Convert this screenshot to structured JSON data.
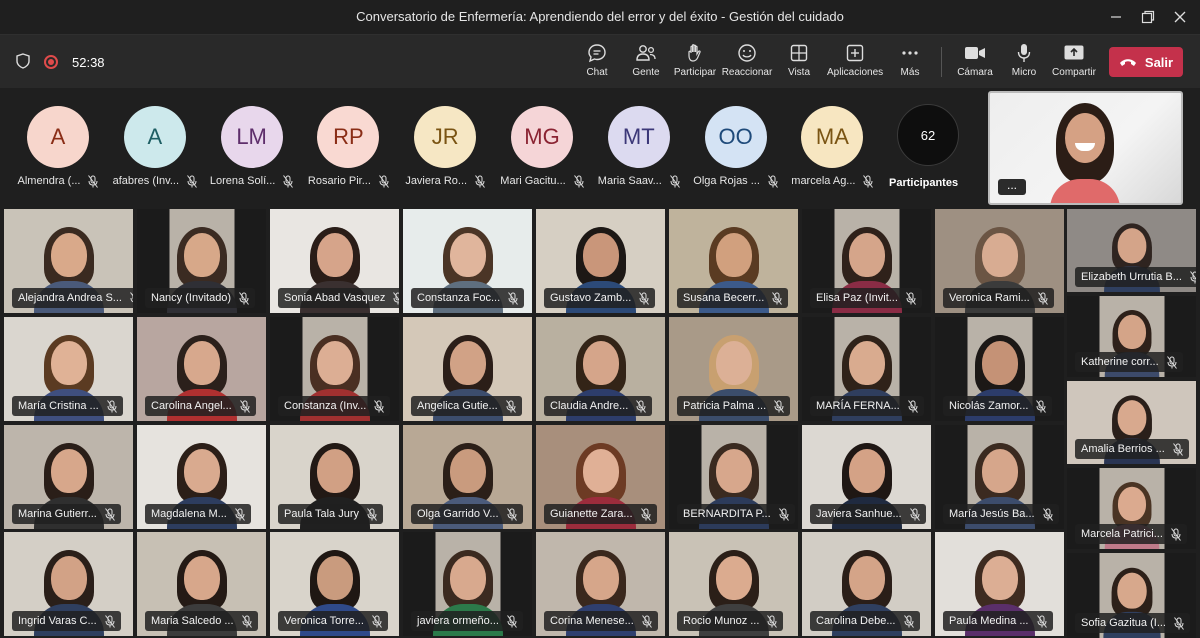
{
  "window": {
    "title": "Conversatorio de Enfermería: Aprendiendo del error y del éxito - Gestión del cuidado"
  },
  "toolbar": {
    "timer": "52:38",
    "buttons": [
      {
        "label": "Chat"
      },
      {
        "label": "Gente"
      },
      {
        "label": "Participar"
      },
      {
        "label": "Reaccionar"
      },
      {
        "label": "Vista"
      },
      {
        "label": "Aplicaciones"
      },
      {
        "label": "Más"
      },
      {
        "label": "Cámara"
      },
      {
        "label": "Micro"
      },
      {
        "label": "Compartir"
      }
    ],
    "leave_label": "Salir"
  },
  "avatars": [
    {
      "initials": "A",
      "name": "Almendra (...",
      "bg": "#f7d6cc",
      "fg": "#8a2d16"
    },
    {
      "initials": "A",
      "name": "afabres (Inv...",
      "bg": "#cde9ec",
      "fg": "#1d5e63"
    },
    {
      "initials": "LM",
      "name": "Lorena Solí...",
      "bg": "#e8d7ec",
      "fg": "#5e2e6b"
    },
    {
      "initials": "RP",
      "name": "Rosario Pir...",
      "bg": "#f9d9d2",
      "fg": "#8a2d16"
    },
    {
      "initials": "JR",
      "name": "Javiera Ro...",
      "bg": "#f6e7c4",
      "fg": "#7a5413"
    },
    {
      "initials": "MG",
      "name": "Mari Gacitu...",
      "bg": "#f5d5d7",
      "fg": "#8a2332"
    },
    {
      "initials": "MT",
      "name": "Maria Saav...",
      "bg": "#dcdaf0",
      "fg": "#3b3778"
    },
    {
      "initials": "OO",
      "name": "Olga Rojas ...",
      "bg": "#d4e3f4",
      "fg": "#1e4a7a"
    },
    {
      "initials": "MA",
      "name": "marcela Ag...",
      "bg": "#f7e6c1",
      "fg": "#7a5413"
    }
  ],
  "participants": {
    "count": "62",
    "label": "Participantes"
  },
  "self_view": {
    "more": "..."
  },
  "videos": [
    {
      "name": "Alejandra Andrea S...",
      "bg": "#c9c3b8",
      "skin": "#d9a98a",
      "hair": "#3a2a20",
      "cloth": "#4a5a7a"
    },
    {
      "name": "Nancy (Invitado)",
      "bg": "#1b1b1b",
      "skin": "#d7a889",
      "hair": "#3b2b22",
      "cloth": "#2f2f35"
    },
    {
      "name": "Sonia Abad Vasquez",
      "bg": "#e9e6e2",
      "skin": "#d6a48a",
      "hair": "#2a1d18",
      "cloth": "#3a3030"
    },
    {
      "name": "Constanza Foc...",
      "bg": "#e7eceb",
      "skin": "#e0b59c",
      "hair": "#4b3526",
      "cloth": "#5f6f7f"
    },
    {
      "name": "Gustavo Zamb...",
      "bg": "#d6cfc3",
      "skin": "#c9967a",
      "hair": "#1d1815",
      "cloth": "#2c4a78"
    },
    {
      "name": "Susana Becerr...",
      "bg": "#bfb39c",
      "skin": "#d1a07e",
      "hair": "#5a3b22",
      "cloth": "#3c5a8a"
    },
    {
      "name": "Elisa Paz (Invit...",
      "bg": "#1b1b1b",
      "skin": "#d5a58a",
      "hair": "#2f211a",
      "cloth": "#8a2c45"
    },
    {
      "name": "Veronica Rami...",
      "bg": "#9e9082",
      "skin": "#d8ac92",
      "hair": "#6b5544",
      "cloth": "#3b3b3b"
    },
    {
      "name": "Elizabeth Urrutia B...",
      "bg": "#8f8a86",
      "skin": "#d4a489",
      "hair": "#2f2420",
      "cloth": "#2f3f5f"
    },
    {
      "name": "María Cristina ...",
      "bg": "#dad6cf",
      "skin": "#e0b296",
      "hair": "#5b3b22",
      "cloth": "#3f4f7f"
    },
    {
      "name": "Carolina Angel...",
      "bg": "#b8a6a0",
      "skin": "#d7a88d",
      "hair": "#2b201b",
      "cloth": "#b03030"
    },
    {
      "name": "Constanza (Inv...",
      "bg": "#1b1b1b",
      "skin": "#dcae94",
      "hair": "#4a2f22",
      "cloth": "#a13030"
    },
    {
      "name": "Angelica Gutie...",
      "bg": "#d4c8b8",
      "skin": "#d1a286",
      "hair": "#2b1e18",
      "cloth": "#3c4d6d"
    },
    {
      "name": "Claudia Andre...",
      "bg": "#b9b0a0",
      "skin": "#d5a58a",
      "hair": "#332417",
      "cloth": "#2d3d6b"
    },
    {
      "name": "Patricia Palma ...",
      "bg": "#a99a88",
      "skin": "#dcb096",
      "hair": "#c8a070",
      "cloth": "#3b4d6b"
    },
    {
      "name": "MARÍA FERNA...",
      "bg": "#1b1b1b",
      "skin": "#d9ab8f",
      "hair": "#2f2219",
      "cloth": "#2f3e5e"
    },
    {
      "name": "Nicolás Zamor...",
      "bg": "#1b1b1b",
      "skin": "#c59276",
      "hair": "#1c1816",
      "cloth": "#2c3c6a"
    },
    {
      "name": "Katherine corr...",
      "bg": "#1b1b1b",
      "skin": "#d4a488",
      "hair": "#2e211a",
      "cloth": "#3c4a6a"
    },
    {
      "name": "Amalia Berrios ...",
      "bg": "#cfc6bc",
      "skin": "#d8a98e",
      "hair": "#2a1f1a",
      "cloth": "#2a3553"
    },
    {
      "name": "Marina Gutierr...",
      "bg": "#bdb5ab",
      "skin": "#d7a78b",
      "hair": "#2a1e18",
      "cloth": "#2f2f2f"
    },
    {
      "name": "Magdalena M...",
      "bg": "#e6e3de",
      "skin": "#d9aa8f",
      "hair": "#2c1f18",
      "cloth": "#2d3d5f"
    },
    {
      "name": "Paula Tala Jury",
      "bg": "#d9d4cb",
      "skin": "#d1a084",
      "hair": "#221915",
      "cloth": "#202020"
    },
    {
      "name": "Olga Garrido V...",
      "bg": "#b8a895",
      "skin": "#c99b7e",
      "hair": "#2b1f18",
      "cloth": "#4b5b7b"
    },
    {
      "name": "Guianette Zara...",
      "bg": "#a88f7c",
      "skin": "#e0b096",
      "hair": "#6d3b24",
      "cloth": "#9c2c3c"
    },
    {
      "name": "BERNARDITA P...",
      "bg": "#1b1b1b",
      "skin": "#d7a78c",
      "hair": "#3a2a20",
      "cloth": "#2c3b5b"
    },
    {
      "name": "Javiera Sanhue...",
      "bg": "#dcd8d2",
      "skin": "#d4a286",
      "hair": "#1f1714",
      "cloth": "#1f2a40"
    },
    {
      "name": "María Jesús Ba...",
      "bg": "#1b1b1b",
      "skin": "#d6a68b",
      "hair": "#3b2a20",
      "cloth": "#3c4c6c"
    },
    {
      "name": "Marcela Patrici...",
      "bg": "#1b1b1b",
      "skin": "#dbaa8f",
      "hair": "#4a3424",
      "cloth": "#c07a8a"
    },
    {
      "name": "Ingrid Varas C...",
      "bg": "#d4cfc6",
      "skin": "#d2a286",
      "hair": "#2a1f19",
      "cloth": "#2f3f5f"
    },
    {
      "name": "Maria Salcedo ...",
      "bg": "#c7c0b4",
      "skin": "#d7a78b",
      "hair": "#241a15",
      "cloth": "#3c3c3c"
    },
    {
      "name": "Veronica Torre...",
      "bg": "#d9d4cb",
      "skin": "#c99b7e",
      "hair": "#1f1713",
      "cloth": "#2f4a8a"
    },
    {
      "name": "javiera ormeño...",
      "bg": "#1b1b1b",
      "skin": "#d8a98e",
      "hair": "#3b2a20",
      "cloth": "#2c7a4a"
    },
    {
      "name": "Corina Menese...",
      "bg": "#c0b7ac",
      "skin": "#d6a68a",
      "hair": "#3a281d",
      "cloth": "#2f3f6f"
    },
    {
      "name": "Rocio Munoz ...",
      "bg": "#c9c2b6",
      "skin": "#dbab8f",
      "hair": "#2b1f18",
      "cloth": "#3f3f3f"
    },
    {
      "name": "Carolina Debe...",
      "bg": "#d2cdc5",
      "skin": "#d4a488",
      "hair": "#2a1e18",
      "cloth": "#2f3f5f"
    },
    {
      "name": "Paula Medina ...",
      "bg": "#e2dfda",
      "skin": "#dcae94",
      "hair": "#3e2b20",
      "cloth": "#5a2f6a"
    },
    {
      "name": "Sofia Gazitua (I...",
      "bg": "#1b1b1b",
      "skin": "#d7a88c",
      "hair": "#2c2019",
      "cloth": "#2f3f5f"
    }
  ]
}
